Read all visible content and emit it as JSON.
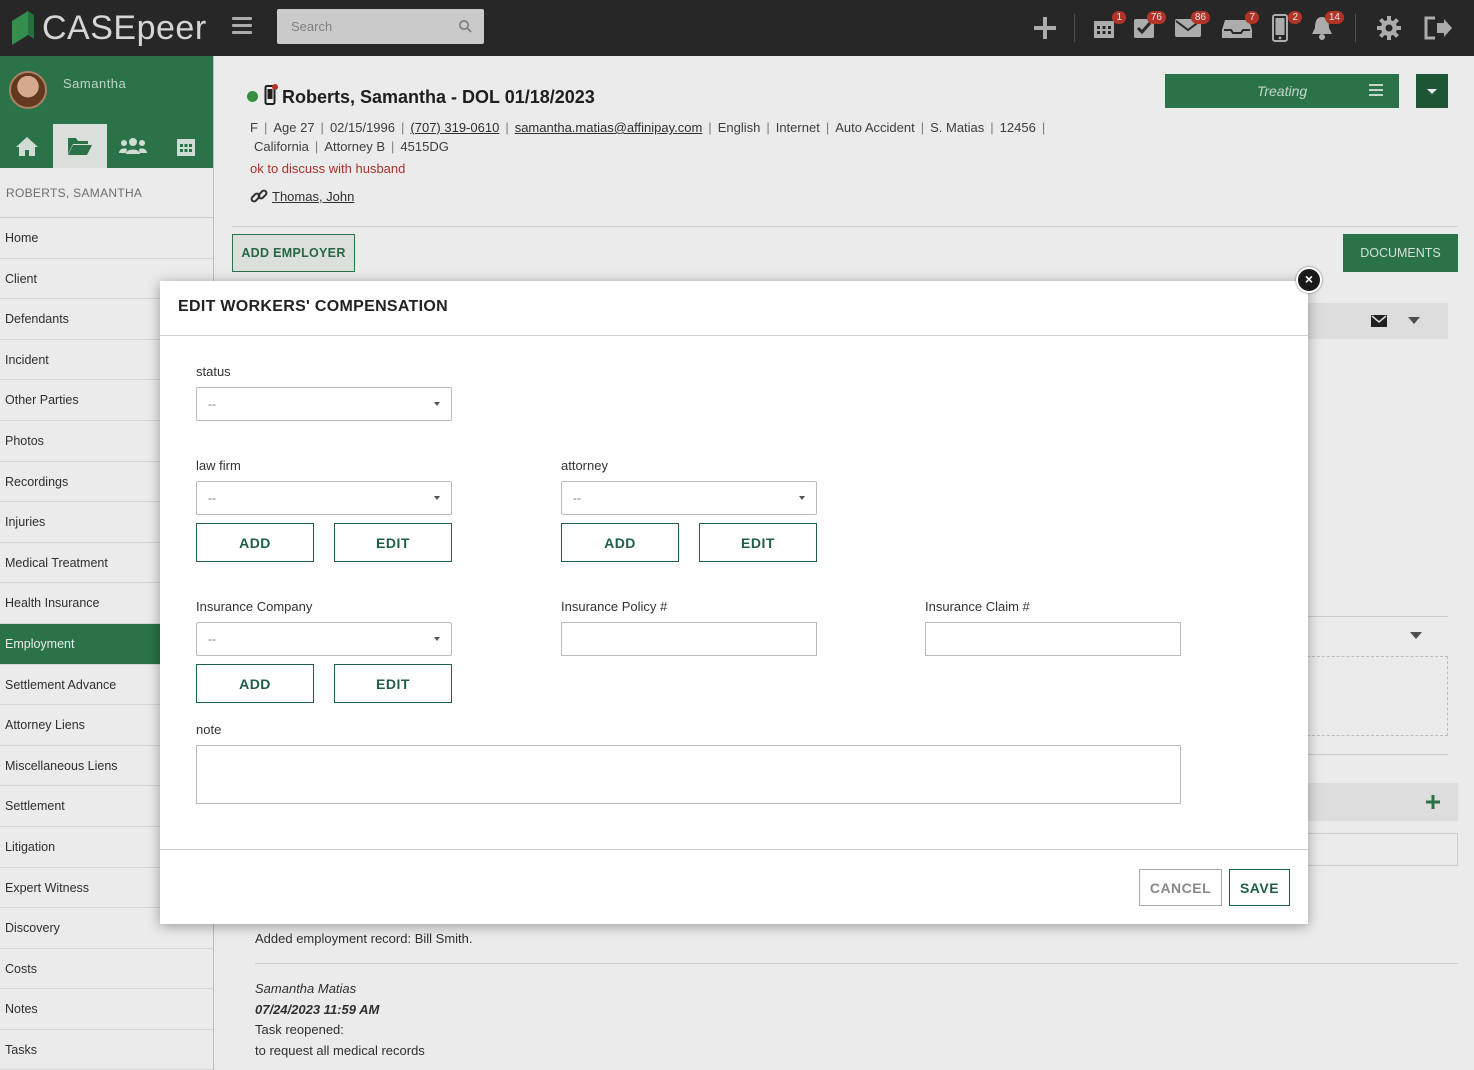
{
  "app": {
    "logo_text": "CASEpeer",
    "brand_color": "#2e7d4f",
    "search_placeholder": "Search"
  },
  "topbar": {
    "icons": [
      {
        "name": "plus-icon"
      },
      {
        "name": "calendar-icon",
        "badge": "1"
      },
      {
        "name": "tasks-check-icon",
        "badge": "76"
      },
      {
        "name": "mail-icon",
        "badge": "86"
      },
      {
        "name": "inbox-icon",
        "badge": "7"
      },
      {
        "name": "mobile-icon",
        "badge": "2"
      },
      {
        "name": "bell-icon",
        "badge": "14"
      },
      {
        "name": "gear-icon"
      },
      {
        "name": "logout-icon"
      }
    ]
  },
  "user": {
    "name": "Samantha"
  },
  "sidebar": {
    "case_header": "ROBERTS, SAMANTHA",
    "items": [
      "Home",
      "Client",
      "Defendants",
      "Incident",
      "Other Parties",
      "Photos",
      "Recordings",
      "Injuries",
      "Medical Treatment",
      "Health Insurance",
      "Employment",
      "Settlement Advance",
      "Attorney Liens",
      "Miscellaneous Liens",
      "Settlement",
      "Litigation",
      "Expert Witness",
      "Discovery",
      "Costs",
      "Notes",
      "Tasks"
    ],
    "active_item": "Employment"
  },
  "case": {
    "title": "Roberts, Samantha - DOL 01/18/2023",
    "gender": "F",
    "age": "Age 27",
    "dob": "02/15/1996",
    "phone": "(707) 319-0610",
    "email": "samantha.matias@affinipay.com",
    "language": "English",
    "source": "Internet",
    "case_type": "Auto Accident",
    "staff": "S. Matias",
    "number": "12456",
    "state": "California",
    "attorney": "Attorney B",
    "code": "4515DG",
    "note": "ok to discuss with husband",
    "linked_contact": "Thomas, John",
    "status": "Treating"
  },
  "actions": {
    "add_employer": "ADD EMPLOYER",
    "documents": "DOCUMENTS"
  },
  "feed": {
    "entry1": "Added employment record: Bill Smith.",
    "author": "Samantha Matias",
    "time": "07/24/2023 11:59 AM",
    "action": "Task reopened:",
    "detail": "to request all medical records"
  },
  "modal": {
    "title": "EDIT WORKERS' COMPENSATION",
    "status_label": "status",
    "status_value": "--",
    "law_firm_label": "law firm",
    "law_firm_value": "--",
    "attorney_label": "attorney",
    "attorney_value": "--",
    "insurance_company_label": "Insurance Company",
    "insurance_company_value": "--",
    "policy_label": "Insurance Policy #",
    "policy_value": "",
    "claim_label": "Insurance Claim #",
    "claim_value": "",
    "note_label": "note",
    "note_value": "",
    "add_label": "ADD",
    "edit_label": "EDIT",
    "cancel_label": "CANCEL",
    "save_label": "SAVE",
    "close_glyph": "×"
  }
}
